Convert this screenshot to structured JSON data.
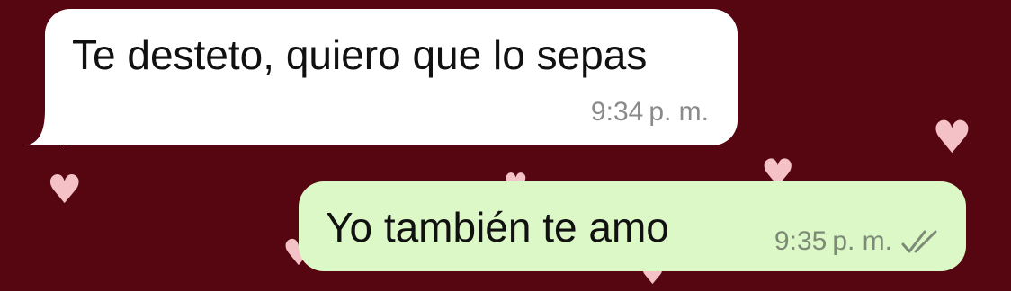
{
  "chat": {
    "background_color": "#560611",
    "messages": [
      {
        "direction": "incoming",
        "text": "Te desteto, quiero que lo sepas",
        "time": "9:34",
        "ampm": "p. m.",
        "bubble_color": "#ffffff"
      },
      {
        "direction": "outgoing",
        "text": "Yo también te amo",
        "time": "9:35",
        "ampm": "p. m.",
        "status_icon": "double-check-icon",
        "bubble_color": "#dcf8c6"
      }
    ],
    "decorations": {
      "icon": "heart-icon",
      "color": "#f3c1c6"
    }
  }
}
